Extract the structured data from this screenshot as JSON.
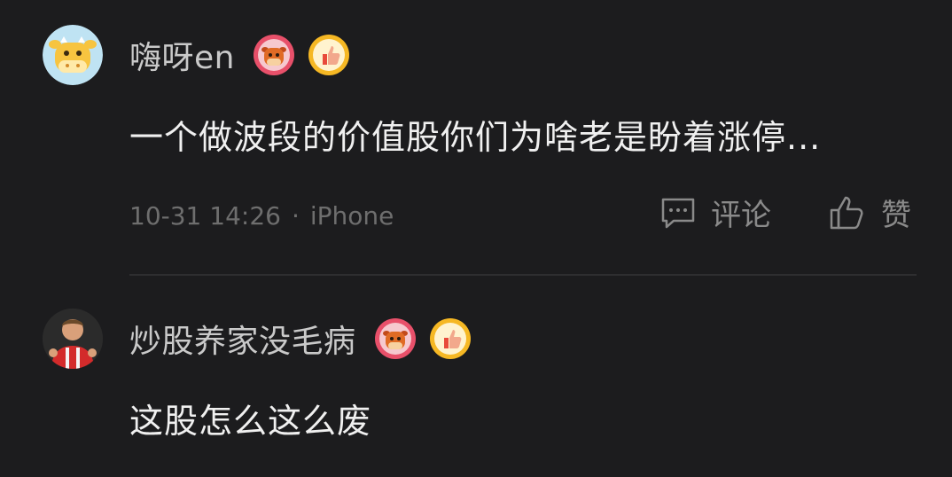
{
  "comments": [
    {
      "username": "嗨呀en",
      "text": "一个做波段的价值股你们为啥老是盼着涨停...",
      "time": "10-31 14:26",
      "separator": "·",
      "device": "iPhone",
      "actions": {
        "comment_label": "评论",
        "like_label": "赞"
      },
      "avatar_icon": "cow-face-icon",
      "badges": [
        "cow-badge-icon",
        "thumbs-up-badge-icon"
      ]
    },
    {
      "username": "炒股养家没毛病",
      "text": "这股怎么这么废",
      "avatar_icon": "user-photo-avatar",
      "badges": [
        "cow-badge-icon",
        "thumbs-up-badge-icon"
      ]
    }
  ],
  "colors": {
    "background": "#1c1c1e",
    "username": "#c9c9c9",
    "text": "#f0f0f0",
    "meta": "#6e6e6e",
    "badge_red": "#e8506a",
    "badge_yellow": "#f6b824"
  }
}
